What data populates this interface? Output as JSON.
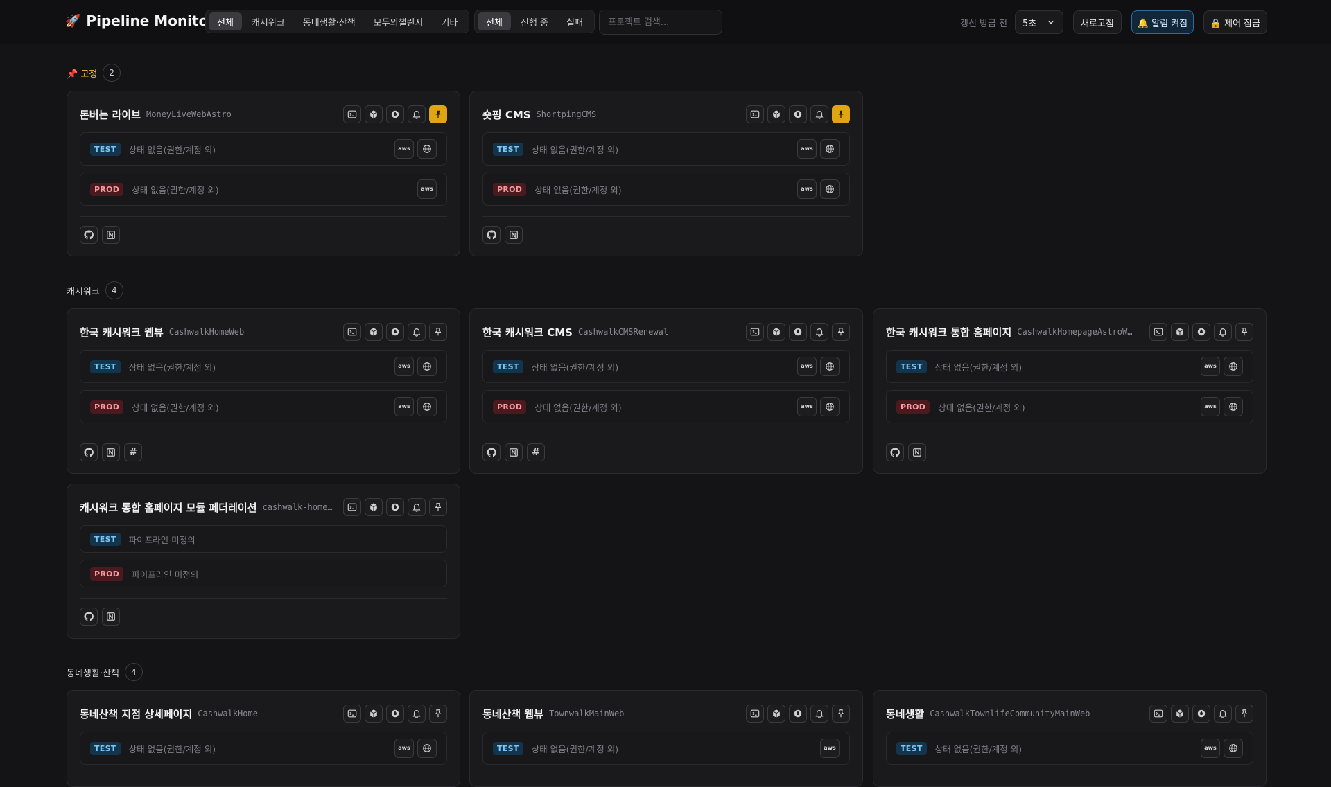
{
  "app": {
    "title": "Pipeline Monitor"
  },
  "filters": {
    "groups": [
      "전체",
      "캐시워크",
      "동네생활·산책",
      "모두의챌린지",
      "기타"
    ],
    "statuses": [
      "전체",
      "진행 중",
      "실패"
    ]
  },
  "search": {
    "placeholder": "프로젝트 검색...",
    "value": ""
  },
  "header": {
    "refresh_text": "갱신 방금 전",
    "interval": "5초",
    "refresh_button": "새로고침",
    "alert_button": "🔔 알림 켜짐",
    "lock_button": "🔒 제어 잠금"
  },
  "sections": [
    {
      "title": "📌 고정",
      "count": "2"
    },
    {
      "title": "캐시워크",
      "count": "4"
    },
    {
      "title": "동네생활·산책",
      "count": "4"
    }
  ],
  "status_texts": {
    "no_status": "상태 없음(권한/계정 외)",
    "undefined": "파이프라인 미정의"
  },
  "env_labels": {
    "test": "TEST",
    "prod": "PROD"
  },
  "icon_labels": {
    "aws": "aws",
    "hash": "#",
    "github": "github-icon",
    "notion": "notion-icon"
  },
  "cards": [
    {
      "title": "돈버는 라이브",
      "repo": "MoneyLiveWebAstro",
      "pinned": true
    },
    {
      "title": "숏핑 CMS",
      "repo": "ShortpingCMS",
      "pinned": true
    },
    {
      "title": "한국 캐시워크 웹뷰",
      "repo": "CashwalkHomeWeb",
      "pinned": false
    },
    {
      "title": "한국 캐시워크 CMS",
      "repo": "CashwalkCMSRenewal",
      "pinned": false
    },
    {
      "title": "한국 캐시워크 통합 홈페이지",
      "repo": "CashwalkHomepageAstroW…",
      "pinned": false
    },
    {
      "title": "캐시워크 통합 홈페이지 모듈 페더레이션",
      "repo": "cashwalk-home…",
      "pinned": false
    },
    {
      "title": "동네산책 지점 상세페이지",
      "repo": "CashwalkHome",
      "pinned": false
    },
    {
      "title": "동네산책 웹뷰",
      "repo": "TownwalkMainWeb",
      "pinned": false
    },
    {
      "title": "동네생활",
      "repo": "CashwalkTownlifeCommunityMainWeb",
      "pinned": false
    }
  ]
}
